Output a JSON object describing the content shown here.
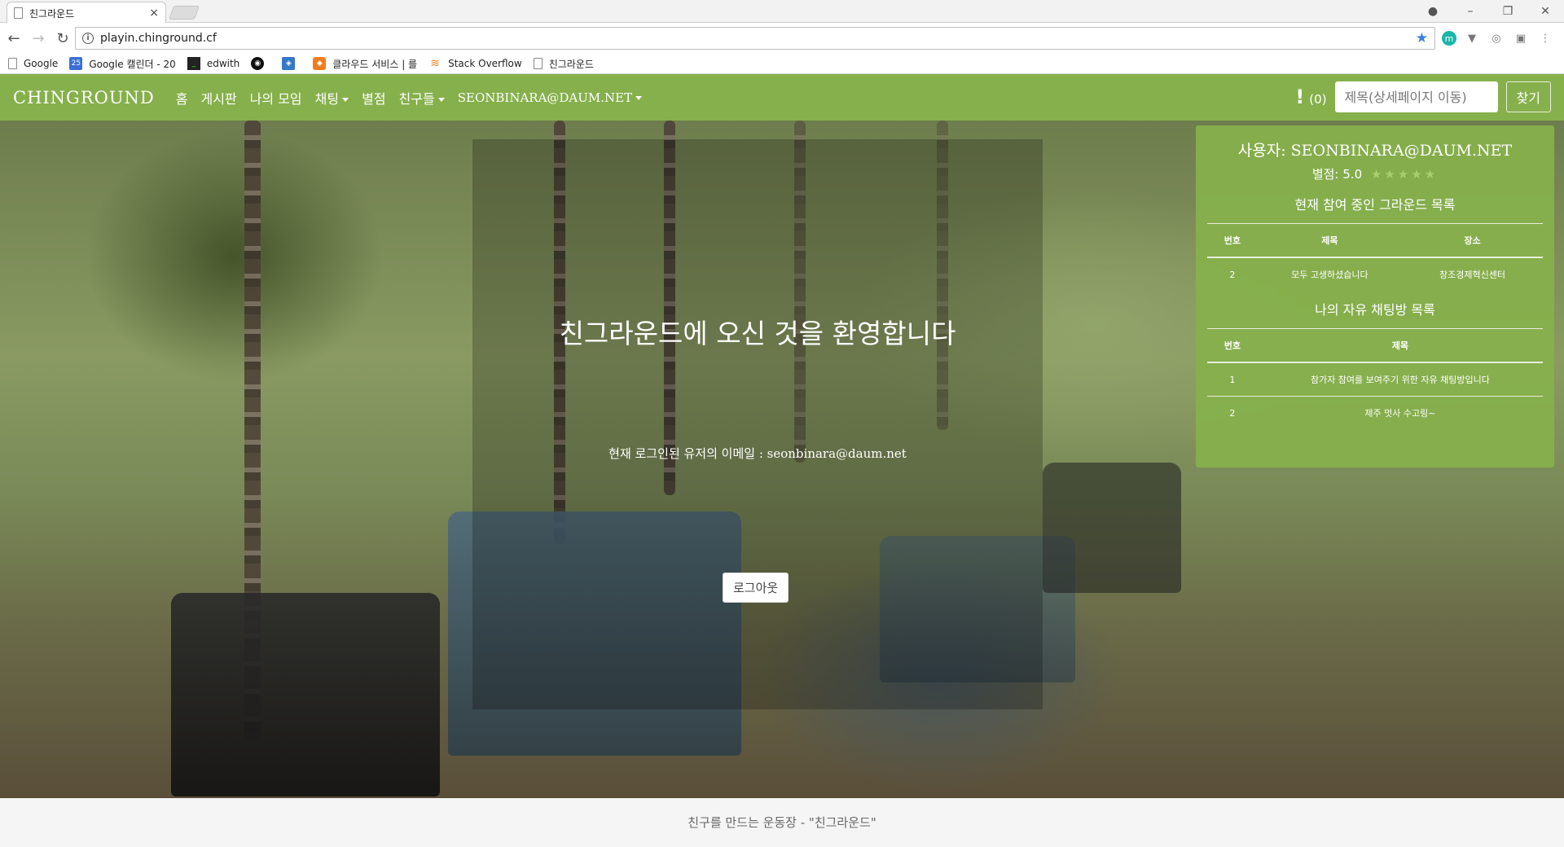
{
  "browser": {
    "tab_title": "친그라운드",
    "tab_close": "×",
    "url": "playin.chinground.cf",
    "window_controls": [
      "–",
      "❐",
      "✕"
    ],
    "bookmarks": [
      {
        "label": "Google",
        "icon": "page-icon"
      },
      {
        "label": "Google 캘린더 - 20",
        "icon": "calendar-icon"
      },
      {
        "label": "edwith",
        "icon": "terminal-icon"
      },
      {
        "label": "",
        "icon": "github-icon"
      },
      {
        "label": "",
        "icon": "app-icon"
      },
      {
        "label": "클라우드 서비스 | 를",
        "icon": "cube-icon"
      },
      {
        "label": "Stack Overflow",
        "icon": "stackoverflow-icon"
      },
      {
        "label": "친그라운드",
        "icon": "page-icon"
      }
    ]
  },
  "navbar": {
    "brand": "CHINGROUND",
    "links": [
      "홈",
      "게시판",
      "나의 모임"
    ],
    "chat": "채팅",
    "rating": "별점",
    "friends": "친구들",
    "account": "SEONBINARA@DAUM.NET",
    "alert_icon": "!",
    "alert_count": "(0)",
    "search_placeholder": "제목(상세페이지 이동)",
    "search_button": "찾기",
    "color": "#86b04b"
  },
  "welcome": {
    "title": "친그라운드에 오신 것을 환영합니다",
    "email_line": "현재 로그인된 유저의 이메일 : seonbinara@daum.net",
    "logout": "로그아웃"
  },
  "panel": {
    "user_label": "사용자:",
    "user": "SEONBINARA@DAUM.NET",
    "rating_label": "별점:",
    "rating_value": "5.0",
    "stars": "★★★★★",
    "grounds_title": "현재 참여 중인 그라운드 목록",
    "grounds_headers": [
      "번호",
      "제목",
      "장소"
    ],
    "grounds_rows": [
      [
        "2",
        "모두 고생하셨습니다",
        "창조경제혁신센터"
      ]
    ],
    "chats_title": "나의 자유 채팅방 목록",
    "chats_headers": [
      "번호",
      "제목"
    ],
    "chats_rows": [
      [
        "1",
        "참가자 참여를 보여주기 위한 자유 채팅방입니다"
      ],
      [
        "2",
        "제주 멋사 수고링~"
      ]
    ]
  },
  "footer": {
    "text": "친구를 만드는 운동장 - \"친그라운드\""
  }
}
